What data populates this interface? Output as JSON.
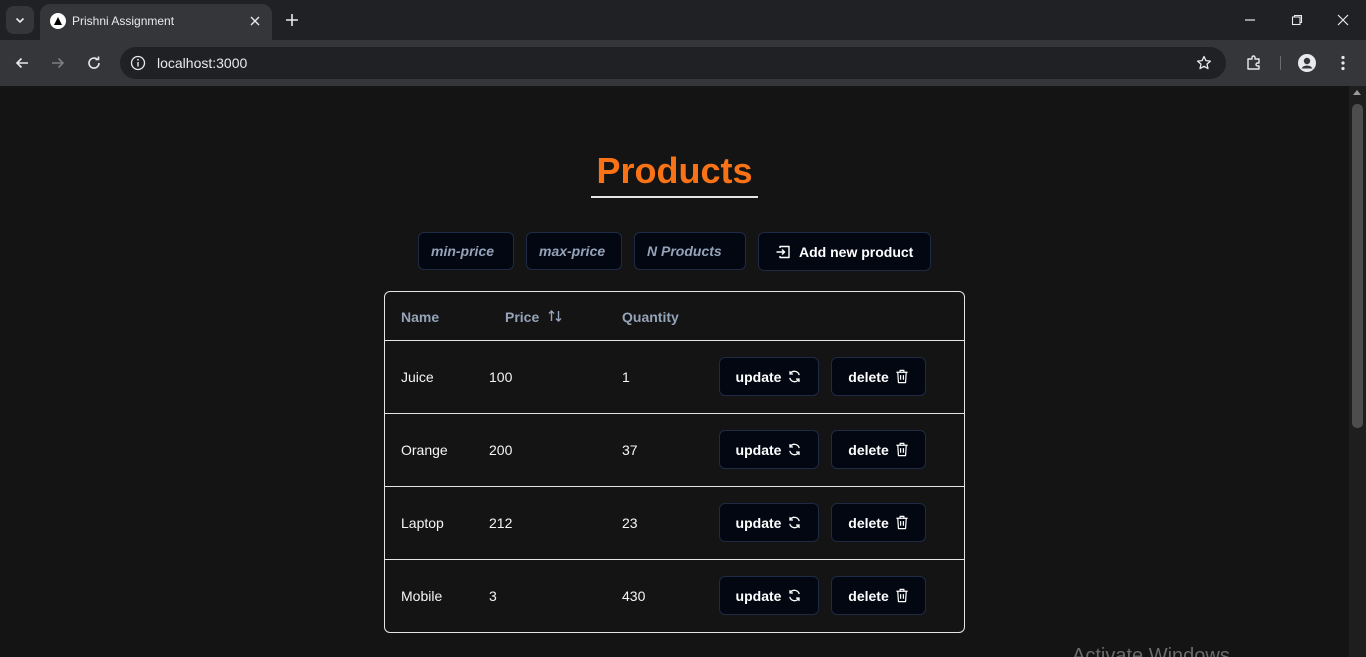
{
  "browser": {
    "tab_title": "Prishni Assignment",
    "url": "localhost:3000"
  },
  "page": {
    "title": "Products",
    "filters": {
      "min_price_placeholder": "min-price",
      "max_price_placeholder": "max-price",
      "n_products_placeholder": "N Products"
    },
    "add_button_label": "Add new product",
    "table": {
      "headers": {
        "name": "Name",
        "price": "Price",
        "quantity": "Quantity"
      },
      "rows": [
        {
          "name": "Juice",
          "price": "100",
          "quantity": "1"
        },
        {
          "name": "Orange",
          "price": "200",
          "quantity": "37"
        },
        {
          "name": "Laptop",
          "price": "212",
          "quantity": "23"
        },
        {
          "name": "Mobile",
          "price": "3",
          "quantity": "430"
        }
      ],
      "update_label": "update",
      "delete_label": "delete"
    },
    "watermark": "Activate Windows"
  },
  "colors": {
    "accent": "#f97316",
    "page_bg": "#141414",
    "button_bg": "#030712"
  },
  "icons": [
    "tab-list-chevron-icon",
    "nextjs-favicon-icon",
    "close-icon",
    "plus-icon",
    "minimize-icon",
    "restore-icon",
    "back-arrow-icon",
    "forward-arrow-icon",
    "reload-icon",
    "site-info-icon",
    "star-icon",
    "extensions-icon",
    "profile-icon",
    "kebab-menu-icon",
    "sort-arrows-icon",
    "import-icon",
    "refresh-icon",
    "trash-icon"
  ]
}
